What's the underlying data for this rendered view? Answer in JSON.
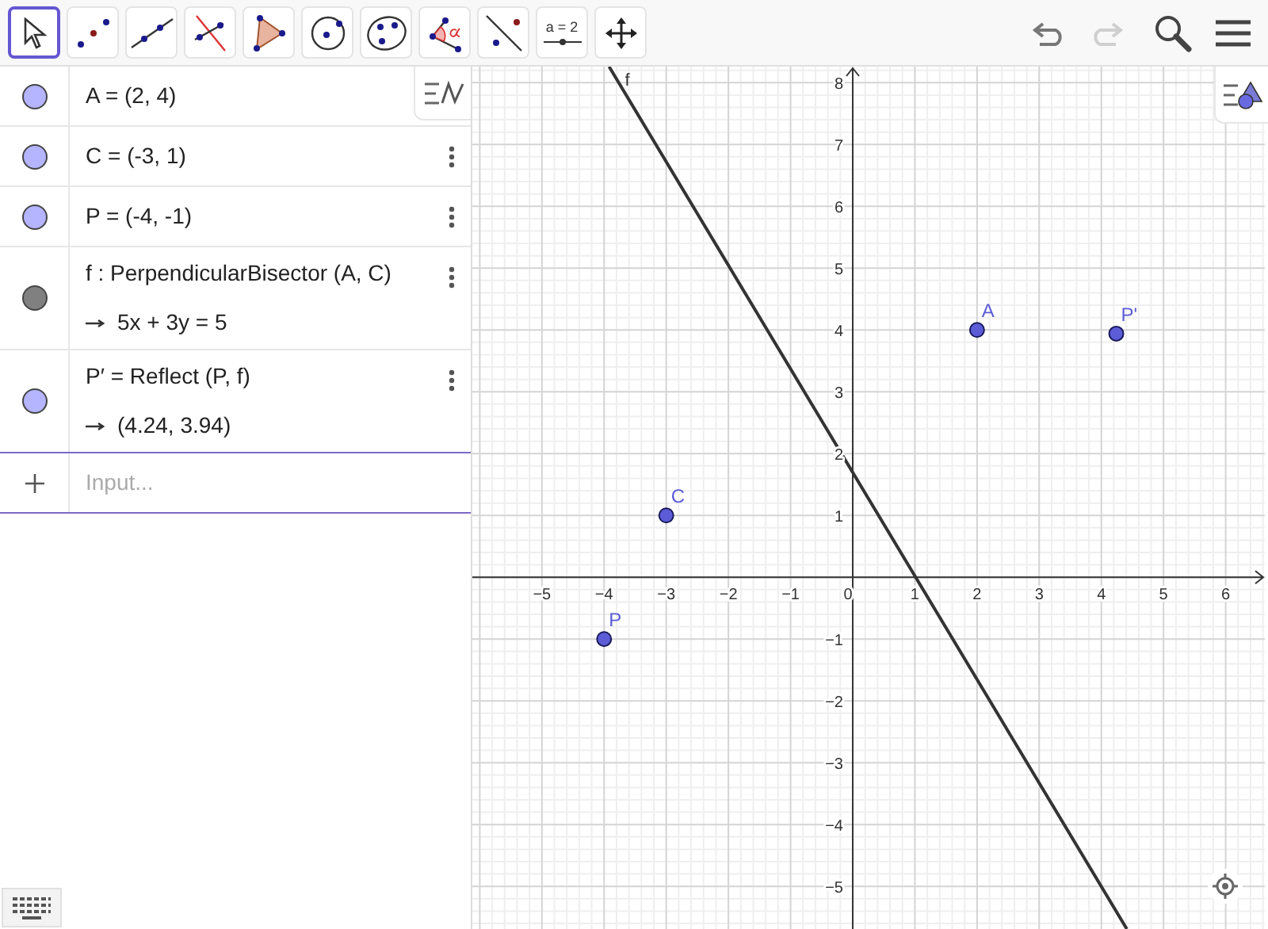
{
  "toolbar": {
    "tools": [
      {
        "kind": "move",
        "selected": true
      },
      {
        "kind": "point",
        "selected": false
      },
      {
        "kind": "line",
        "selected": false
      },
      {
        "kind": "perpendicular",
        "selected": false
      },
      {
        "kind": "polygon",
        "selected": false
      },
      {
        "kind": "circle",
        "selected": false
      },
      {
        "kind": "conic",
        "selected": false
      },
      {
        "kind": "angle",
        "selected": false
      },
      {
        "kind": "reflect",
        "selected": false
      },
      {
        "kind": "slider",
        "selected": false,
        "label": "a = 2"
      },
      {
        "kind": "move_view",
        "selected": false
      }
    ],
    "actions": [
      {
        "kind": "undo",
        "disabled": false
      },
      {
        "kind": "redo",
        "disabled": true
      },
      {
        "kind": "search"
      },
      {
        "kind": "menu"
      }
    ]
  },
  "algebra": {
    "items": [
      {
        "kind": "value",
        "text": "A = (2, 4)",
        "color": "#b4b4ff",
        "menu_button": false
      },
      {
        "kind": "value",
        "text": "C = (-3, 1)",
        "color": "#b4b4ff",
        "menu_button": true
      },
      {
        "kind": "value",
        "text": "P = (-4, -1)",
        "color": "#b4b4ff",
        "menu_button": true
      },
      {
        "kind": "definition",
        "text": "f : PerpendicularBisector (A, C)",
        "output": "5x + 3y = 5",
        "color": "#808080",
        "menu_button": true
      },
      {
        "kind": "definition",
        "text": "P′ = Reflect (P, f)",
        "output": "(4.24, 3.94)",
        "color": "#b4b4ff",
        "menu_button": true
      }
    ],
    "input": {
      "placeholder": "Input..."
    }
  },
  "graph": {
    "line": {
      "label": "f"
    },
    "chart_data": {
      "type": "scatter",
      "x": [
        2,
        -3,
        -4,
        4.24
      ],
      "series": [
        {
          "name": "A",
          "color": "#5c5cd6",
          "values": [
            4,
            null,
            null,
            null
          ]
        },
        {
          "name": "C",
          "color": "#5c5cd6",
          "values": [
            null,
            1,
            null,
            null
          ]
        },
        {
          "name": "P",
          "color": "#5c5cd6",
          "values": [
            null,
            null,
            -1,
            null
          ]
        },
        {
          "name": "P'",
          "color": "#5c5cd6",
          "values": [
            null,
            null,
            null,
            3.94
          ]
        }
      ],
      "xlim": [
        -6.12,
        6.63
      ],
      "ylim": [
        -5.69,
        8.26
      ],
      "xticks": [
        -5,
        -4,
        -3,
        -2,
        -1,
        0,
        1,
        2,
        3,
        4,
        5,
        6
      ],
      "yticks": [
        -5,
        -4,
        -3,
        -2,
        -1,
        1,
        2,
        3,
        4,
        5,
        6,
        7,
        8
      ],
      "grid": true
    }
  }
}
